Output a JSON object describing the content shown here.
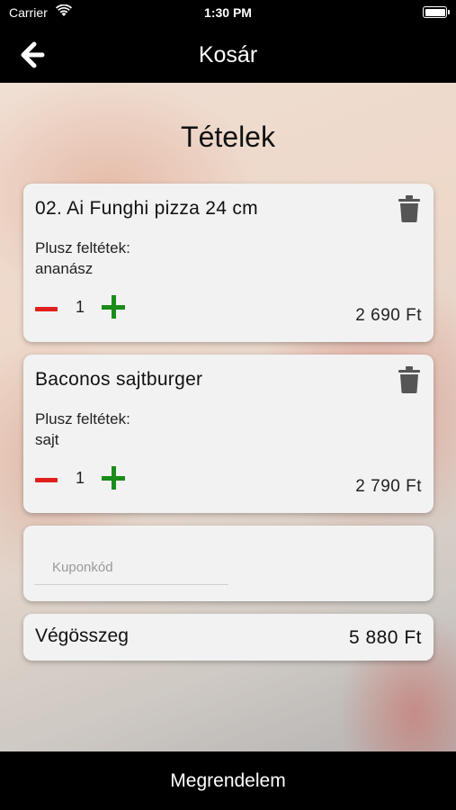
{
  "status_bar": {
    "carrier": "Carrier",
    "time": "1:30 PM"
  },
  "nav": {
    "title": "Kosár",
    "back_icon": "arrow-left-icon"
  },
  "section_title": "Tételek",
  "items": [
    {
      "name": "02. Ai Funghi pizza 24 cm",
      "extras_label": "Plusz feltétek:",
      "extras": "ananász",
      "quantity": "1",
      "price": "2 690 Ft"
    },
    {
      "name": "Baconos sajtburger",
      "extras_label": "Plusz feltétek:",
      "extras": "sajt",
      "quantity": "1",
      "price": "2 790 Ft"
    }
  ],
  "coupon": {
    "placeholder": "Kuponkód",
    "value": ""
  },
  "total": {
    "label": "Végösszeg",
    "value": "5 880 Ft"
  },
  "order_button": {
    "label": "Megrendelem"
  },
  "colors": {
    "minus": "#e0201c",
    "plus": "#1a8c1a",
    "bar": "#000000",
    "card": "#f2f2f2"
  }
}
